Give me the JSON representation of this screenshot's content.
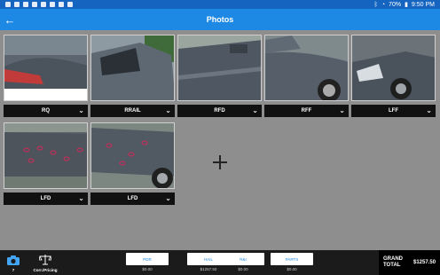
{
  "status_bar": {
    "battery": "70%",
    "time": "9:50 PM"
  },
  "app_bar": {
    "title": "Photos",
    "back_icon": "arrow-left-icon"
  },
  "photos": [
    {
      "label": "RQ"
    },
    {
      "label": "RRAIL"
    },
    {
      "label": "RFD"
    },
    {
      "label": "RFF"
    },
    {
      "label": "LFF"
    },
    {
      "label": "LFD"
    },
    {
      "label": "LFD"
    }
  ],
  "add_icon": "plus-icon",
  "bottom_bar": {
    "camera": {
      "icon": "camera-icon",
      "label": "7"
    },
    "pricing": {
      "icon": "scale-icon",
      "label": "Corr./Pricing"
    },
    "amounts": [
      {
        "button": "PDR",
        "value": "$0.00"
      },
      {
        "button": "HAIL",
        "value": "$1257.50"
      },
      {
        "button": "R&I",
        "value": "$0.00"
      },
      {
        "button": "PARTS",
        "value": "$0.00"
      }
    ],
    "grand_total": {
      "label": "GRAND TOTAL",
      "value": "$1257.50"
    }
  },
  "colors": {
    "status_bar": "#1565c0",
    "app_bar": "#1e88e5",
    "background": "#8e8e8e",
    "caption_bar": "#111111",
    "bottom_bar": "#1b1b1b",
    "accent_blue": "#1e88e5"
  }
}
